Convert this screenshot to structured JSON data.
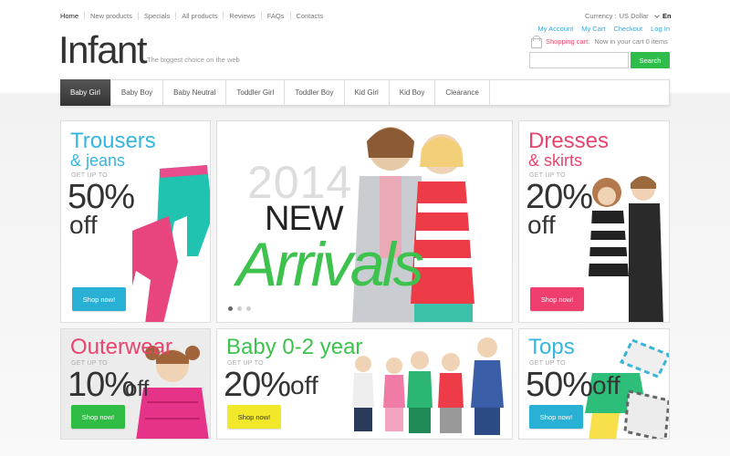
{
  "topnav": [
    "Home",
    "New products",
    "Specials",
    "All products",
    "Reviews",
    "FAQs",
    "Contacts"
  ],
  "currency": {
    "label": "Currency :",
    "value": "US Dollar"
  },
  "language": "En",
  "account_links": [
    "My Account",
    "My Cart",
    "Checkout",
    "Log In"
  ],
  "logo": {
    "text": "Infant",
    "tagline": "The biggest choice on the web"
  },
  "cart": {
    "label": "Shopping cart:",
    "status": "Now in your cart 0 items"
  },
  "search": {
    "placeholder": "",
    "button": "Search"
  },
  "menu": [
    "Baby Girl",
    "Baby Boy",
    "Baby Neutral",
    "Toddler Girl",
    "Toddler Boy",
    "Kid Girl",
    "Kid Boy",
    "Clearance"
  ],
  "banners": {
    "trousers": {
      "line1": "Trousers",
      "line2": "& jeans",
      "getup": "GET UP TO",
      "percent": "50%",
      "off": "off",
      "button": "Shop now!"
    },
    "dresses": {
      "line1": "Dresses",
      "line2": "& skirts",
      "getup": "GET UP TO",
      "percent": "20%",
      "off": "off",
      "button": "Shop now!"
    },
    "outerwear": {
      "title": "Outerwear",
      "getup": "GET UP TO",
      "percent": "10%",
      "off": "off",
      "button": "Shop now!"
    },
    "baby": {
      "title": "Baby 0-2 year",
      "getup": "GET UP TO",
      "percent": "20%",
      "off": "off",
      "button": "Shop now!"
    },
    "tops": {
      "title": "Tops",
      "getup": "GET UP TO",
      "percent": "50%",
      "off": "off",
      "button": "Shop now!"
    }
  },
  "slider": {
    "year": "2014",
    "word1": "NEW",
    "word2": "Arrivals",
    "slides": 3,
    "active_slide": 1
  },
  "colors": {
    "accent_blue": "#35b6de",
    "accent_pink": "#e8456e",
    "accent_green": "#3ec24e",
    "accent_yellow": "#f1e82a"
  }
}
